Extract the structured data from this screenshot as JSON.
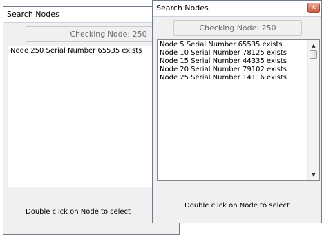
{
  "back_window": {
    "title": "Search Nodes",
    "status": "Checking Node: 250",
    "items": [
      "Node 250 Serial Number 65535 exists"
    ],
    "hint": "Double click on Node to select"
  },
  "front_window": {
    "title": "Search Nodes",
    "close_glyph": "✕",
    "status": "Checking Node: 250",
    "items": [
      "Node 5 Serial Number 65535 exists",
      "Node 10 Serial Number 78125 exists",
      "Node 15 Serial Number 44335 exists",
      "Node 20 Serial Number 79102 exists",
      "Node 25 Serial Number 14116 exists"
    ],
    "scroll_up_glyph": "▲",
    "scroll_down_glyph": "▼",
    "hint": "Double click on Node to select"
  }
}
